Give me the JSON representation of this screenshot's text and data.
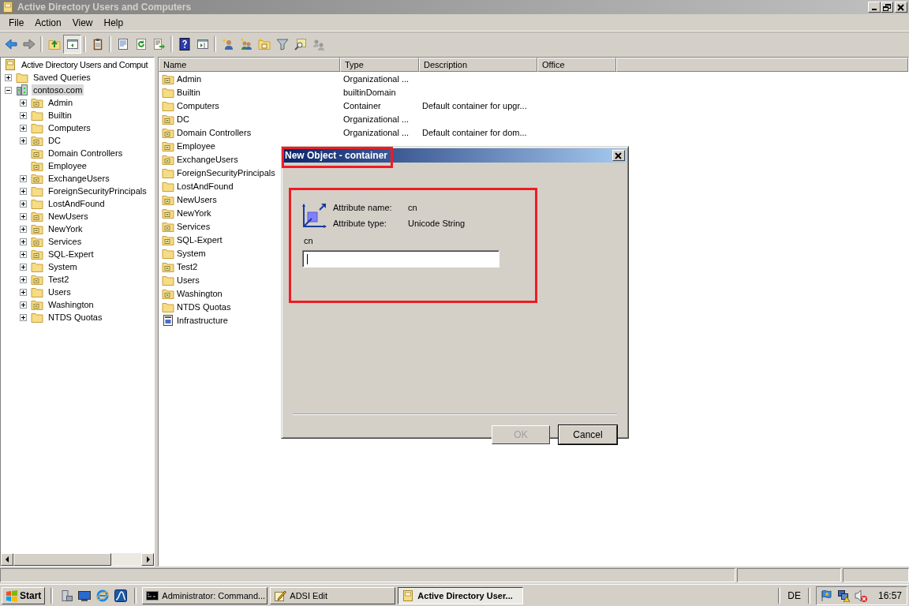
{
  "window": {
    "title": "Active Directory Users and Computers",
    "active": false
  },
  "menu": [
    "File",
    "Action",
    "View",
    "Help"
  ],
  "toolbar": [
    {
      "pressed": false
    },
    {
      "pressed": false
    },
    {
      "pressed": false
    },
    {
      "pressed": true
    },
    {
      "pressed": false
    },
    {
      "pressed": false
    },
    {
      "pressed": false
    },
    {
      "pressed": false
    },
    {
      "pressed": false
    },
    {
      "pressed": false
    },
    {
      "pressed": false
    },
    {
      "pressed": false
    },
    {
      "pressed": false
    },
    {
      "pressed": false
    },
    {
      "pressed": false
    },
    {
      "pressed": false
    }
  ],
  "tree": [
    {
      "label": "Active Directory Users and Comput",
      "kind": "root",
      "selected": false,
      "children": [
        {
          "label": "Saved Queries",
          "kind": "container",
          "expandable": true,
          "expanded": false,
          "selected": false
        },
        {
          "label": "contoso.com",
          "kind": "domain",
          "expandable": true,
          "expanded": true,
          "selected": true,
          "children": [
            {
              "label": "Admin",
              "kind": "ou",
              "expandable": true,
              "expanded": false,
              "selected": false
            },
            {
              "label": "Builtin",
              "kind": "container",
              "expandable": true,
              "expanded": false,
              "selected": false
            },
            {
              "label": "Computers",
              "kind": "container",
              "expandable": true,
              "expanded": false,
              "selected": false
            },
            {
              "label": "DC",
              "kind": "ou",
              "expandable": true,
              "expanded": false,
              "selected": false
            },
            {
              "label": "Domain Controllers",
              "kind": "ou",
              "expandable": false,
              "selected": false
            },
            {
              "label": "Employee",
              "kind": "ou",
              "expandable": false,
              "selected": false
            },
            {
              "label": "ExchangeUsers",
              "kind": "ou",
              "expandable": true,
              "expanded": false,
              "selected": false
            },
            {
              "label": "ForeignSecurityPrincipals",
              "kind": "container",
              "expandable": true,
              "expanded": false,
              "selected": false
            },
            {
              "label": "LostAndFound",
              "kind": "container",
              "expandable": true,
              "expanded": false,
              "selected": false
            },
            {
              "label": "NewUsers",
              "kind": "ou",
              "expandable": true,
              "expanded": false,
              "selected": false
            },
            {
              "label": "NewYork",
              "kind": "ou",
              "expandable": true,
              "expanded": false,
              "selected": false
            },
            {
              "label": "Services",
              "kind": "ou",
              "expandable": true,
              "expanded": false,
              "selected": false
            },
            {
              "label": "SQL-Expert",
              "kind": "ou",
              "expandable": true,
              "expanded": false,
              "selected": false
            },
            {
              "label": "System",
              "kind": "container",
              "expandable": true,
              "expanded": false,
              "selected": false
            },
            {
              "label": "Test2",
              "kind": "ou",
              "expandable": true,
              "expanded": false,
              "selected": false
            },
            {
              "label": "Users",
              "kind": "container",
              "expandable": true,
              "expanded": false,
              "selected": false
            },
            {
              "label": "Washington",
              "kind": "ou",
              "expandable": true,
              "expanded": false,
              "selected": false
            },
            {
              "label": "NTDS Quotas",
              "kind": "container",
              "expandable": true,
              "expanded": false,
              "selected": false
            }
          ]
        }
      ]
    }
  ],
  "list": {
    "columns": [
      "Name",
      "Type",
      "Description",
      "Office"
    ],
    "rows": [
      {
        "kind": "ou",
        "name": "Admin",
        "type": "Organizational ..."
      },
      {
        "kind": "container",
        "name": "Builtin",
        "type": "builtinDomain"
      },
      {
        "kind": "container",
        "name": "Computers",
        "type": "Container",
        "description": "Default container for upgr..."
      },
      {
        "kind": "ou",
        "name": "DC",
        "type": "Organizational ..."
      },
      {
        "kind": "ou",
        "name": "Domain Controllers",
        "type": "Organizational ...",
        "description": "Default container for dom..."
      },
      {
        "kind": "ou",
        "name": "Employee"
      },
      {
        "kind": "ou",
        "name": "ExchangeUsers"
      },
      {
        "kind": "container",
        "name": "ForeignSecurityPrincipals"
      },
      {
        "kind": "container",
        "name": "LostAndFound"
      },
      {
        "kind": "ou",
        "name": "NewUsers"
      },
      {
        "kind": "ou",
        "name": "NewYork"
      },
      {
        "kind": "ou",
        "name": "Services"
      },
      {
        "kind": "ou",
        "name": "SQL-Expert"
      },
      {
        "kind": "container",
        "name": "System"
      },
      {
        "kind": "ou",
        "name": "Test2"
      },
      {
        "kind": "container",
        "name": "Users"
      },
      {
        "kind": "ou",
        "name": "Washington"
      },
      {
        "kind": "container",
        "name": "NTDS Quotas"
      },
      {
        "kind": "infrastructure",
        "name": "Infrastructure"
      }
    ]
  },
  "dialog": {
    "title": "New Object - container",
    "attributes": [
      {
        "label": "Attribute name:",
        "value": "cn"
      },
      {
        "label": "Attribute type:",
        "value": "Unicode String"
      }
    ],
    "input": {
      "label": "cn",
      "focused": true
    },
    "buttons": [
      {
        "label": "OK",
        "disabled": true,
        "default": false
      },
      {
        "label": "Cancel",
        "disabled": false,
        "default": true
      }
    ]
  },
  "taskbar": {
    "start": "Start",
    "tasks": [
      {
        "kind": "console",
        "label": "Administrator: Command...",
        "selected": false
      },
      {
        "kind": "editor",
        "label": "ADSI Edit",
        "selected": false
      },
      {
        "kind": "snapin",
        "label": "Active Directory User...",
        "selected": true
      }
    ],
    "language": "DE",
    "clock": "16:57"
  }
}
